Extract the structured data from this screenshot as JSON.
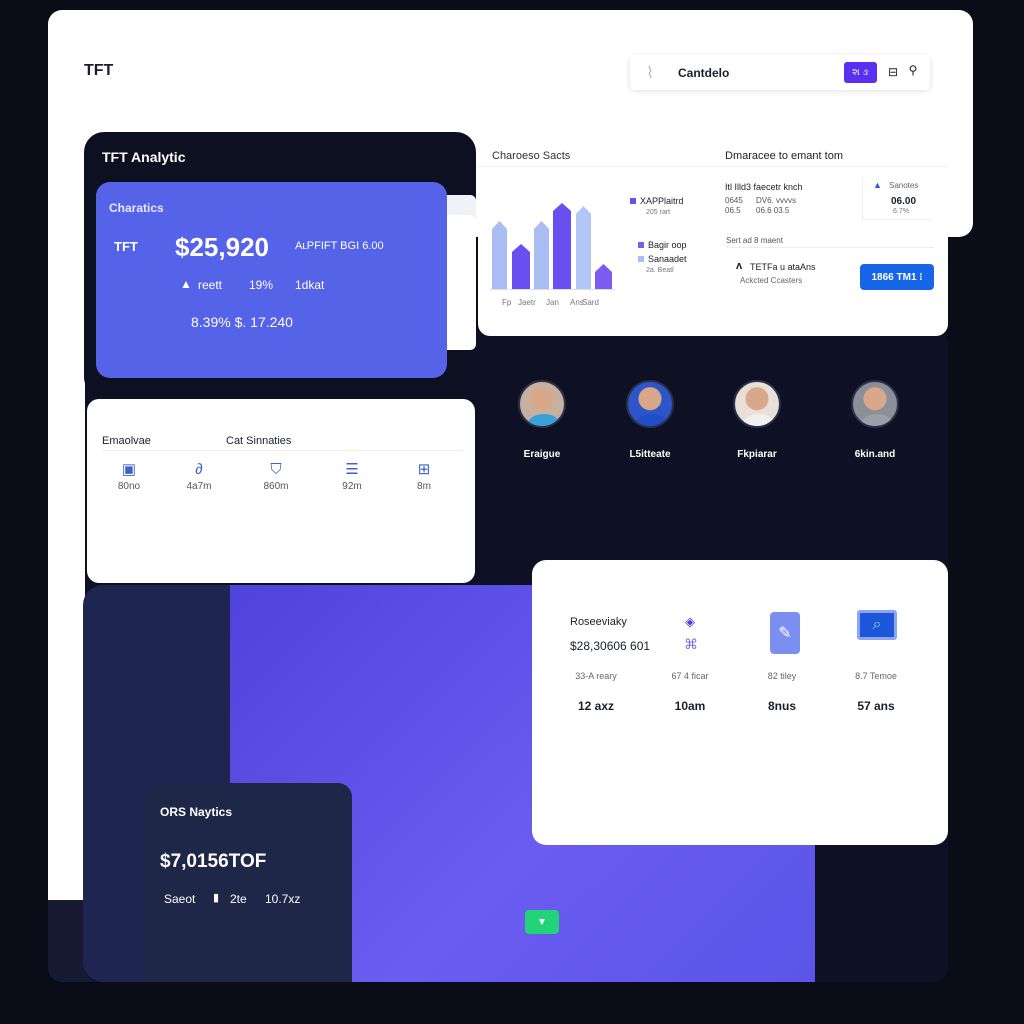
{
  "header": {
    "logo": "TFT",
    "search_value": "Cantdelo",
    "action_label": "શ ઙ"
  },
  "summary": {
    "title": "TFT Analytic",
    "card_title": "Charatics",
    "ticker": "TFT",
    "amount": "$25,920",
    "amount_note": "AʟPFIFT BGI 6.00",
    "stat1": "reett",
    "stat2": "19%",
    "stat3": "1dkat",
    "footer": "8.39% $. 17.240"
  },
  "chart_card": {
    "title": "Charoeso Sacts",
    "legend": [
      {
        "label": "XAPPlaitrd",
        "sub": "205 rart",
        "color": "#6a4ff0"
      },
      {
        "label": "Bagir oop",
        "color": "#7a5cf0"
      },
      {
        "label": "Sanaadet",
        "sub": "2a. Beatl",
        "color": "#a9bdf2"
      }
    ],
    "bars": {
      "values": [
        68,
        45,
        68,
        86,
        83,
        25
      ],
      "colors": [
        "#a9bdf2",
        "#6a4ff0",
        "#a9bdf2",
        "#6a4ff0",
        "#b4c6f5",
        "#7a5cf0"
      ]
    },
    "xlabels": [
      "Fp",
      "Jaetr",
      "Jan",
      "Ans",
      "Sard"
    ]
  },
  "compare_card": {
    "title": "Dmaracee to emant tom",
    "row_title": "Itl Illd3 faecetr knch",
    "row_values": [
      "0645",
      "DV6. vvvvs",
      "06.5",
      "06.6 03.5"
    ],
    "side_label": "Sanotes",
    "side_value": "06.00",
    "side_sub": "6.7%",
    "section": "Sert ad 8 maent",
    "item_title": "TETFa u ataAns",
    "item_sub": "Ackcted Ccasters",
    "button": "1866 TM1 ⁝"
  },
  "people": [
    {
      "name": "Eraigue"
    },
    {
      "name": "L5itteate"
    },
    {
      "name": "Fkpiarar"
    },
    {
      "name": "6kin.and"
    }
  ],
  "emp_card": {
    "tab1": "Emaolvae",
    "tab2": "Cat Sinnaties",
    "items": [
      {
        "icon": "image-icon",
        "value": "80no"
      },
      {
        "icon": "link-icon",
        "value": "4a7m"
      },
      {
        "icon": "map-icon",
        "value": "860m"
      },
      {
        "icon": "document-icon",
        "value": "92m"
      },
      {
        "icon": "sliders-icon",
        "value": "8m"
      }
    ]
  },
  "resource_card": {
    "title": "Roseeviaky",
    "amount": "$28,30606 601",
    "cols": [
      {
        "label": "33-A reary",
        "value": "12 axz"
      },
      {
        "label": "67 4 ficar",
        "value": "10am"
      },
      {
        "label": "82 tiley",
        "value": "8nus"
      },
      {
        "label": "8.7 Temoe",
        "value": "57 ans"
      }
    ]
  },
  "ops_card": {
    "title": "ORS Naytics",
    "amount": "$7,0156TOF",
    "label": "Saeot",
    "v1": "2te",
    "v2": "10.7xz"
  },
  "colors": {
    "accent": "#5563e8",
    "purple": "#5a4ae8",
    "navy": "#1e2748",
    "green": "#22d37a",
    "button_blue": "#1766e8"
  }
}
